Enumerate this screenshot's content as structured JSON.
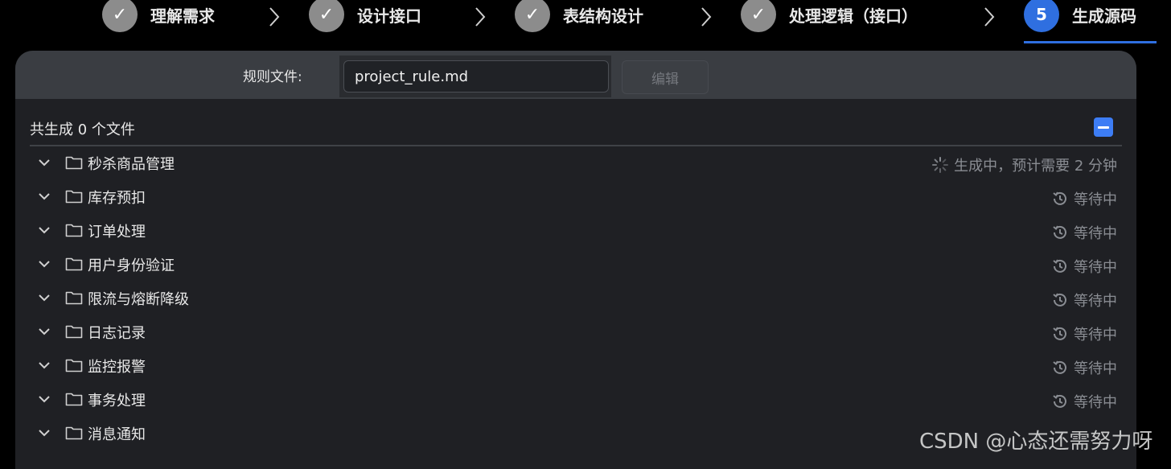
{
  "steps": [
    {
      "label": "理解需求",
      "state": "done",
      "icon": "check-icon"
    },
    {
      "label": "设计接口",
      "state": "done",
      "icon": "check-icon"
    },
    {
      "label": "表结构设计",
      "state": "done",
      "icon": "check-icon"
    },
    {
      "label": "处理逻辑（接口）",
      "state": "done",
      "icon": "check-icon"
    },
    {
      "label": "生成源码",
      "state": "active",
      "number": "5"
    }
  ],
  "rule": {
    "label": "规则文件:",
    "value": "project_rule.md",
    "edit_label": "编辑"
  },
  "summary": "共生成 0 个文件",
  "modules": [
    {
      "name": "秒杀商品管理",
      "status": "生成中，预计需要 2 分钟",
      "status_icon": "loading-spinner-icon"
    },
    {
      "name": "库存预扣",
      "status": "等待中",
      "status_icon": "history-icon"
    },
    {
      "name": "订单处理",
      "status": "等待中",
      "status_icon": "history-icon"
    },
    {
      "name": "用户身份验证",
      "status": "等待中",
      "status_icon": "history-icon"
    },
    {
      "name": "限流与熔断降级",
      "status": "等待中",
      "status_icon": "history-icon"
    },
    {
      "name": "日志记录",
      "status": "等待中",
      "status_icon": "history-icon"
    },
    {
      "name": "监控报警",
      "status": "等待中",
      "status_icon": "history-icon"
    },
    {
      "name": "事务处理",
      "status": "等待中",
      "status_icon": "history-icon"
    },
    {
      "name": "消息通知",
      "status": "",
      "status_icon": ""
    }
  ],
  "watermark": "CSDN @心态还需努力呀",
  "colors": {
    "accent": "#2f6fe0",
    "done_step": "#8c8c8c",
    "panel": "#1f2024",
    "header_bar": "#3a3d42",
    "muted_text": "#8a8d93"
  }
}
